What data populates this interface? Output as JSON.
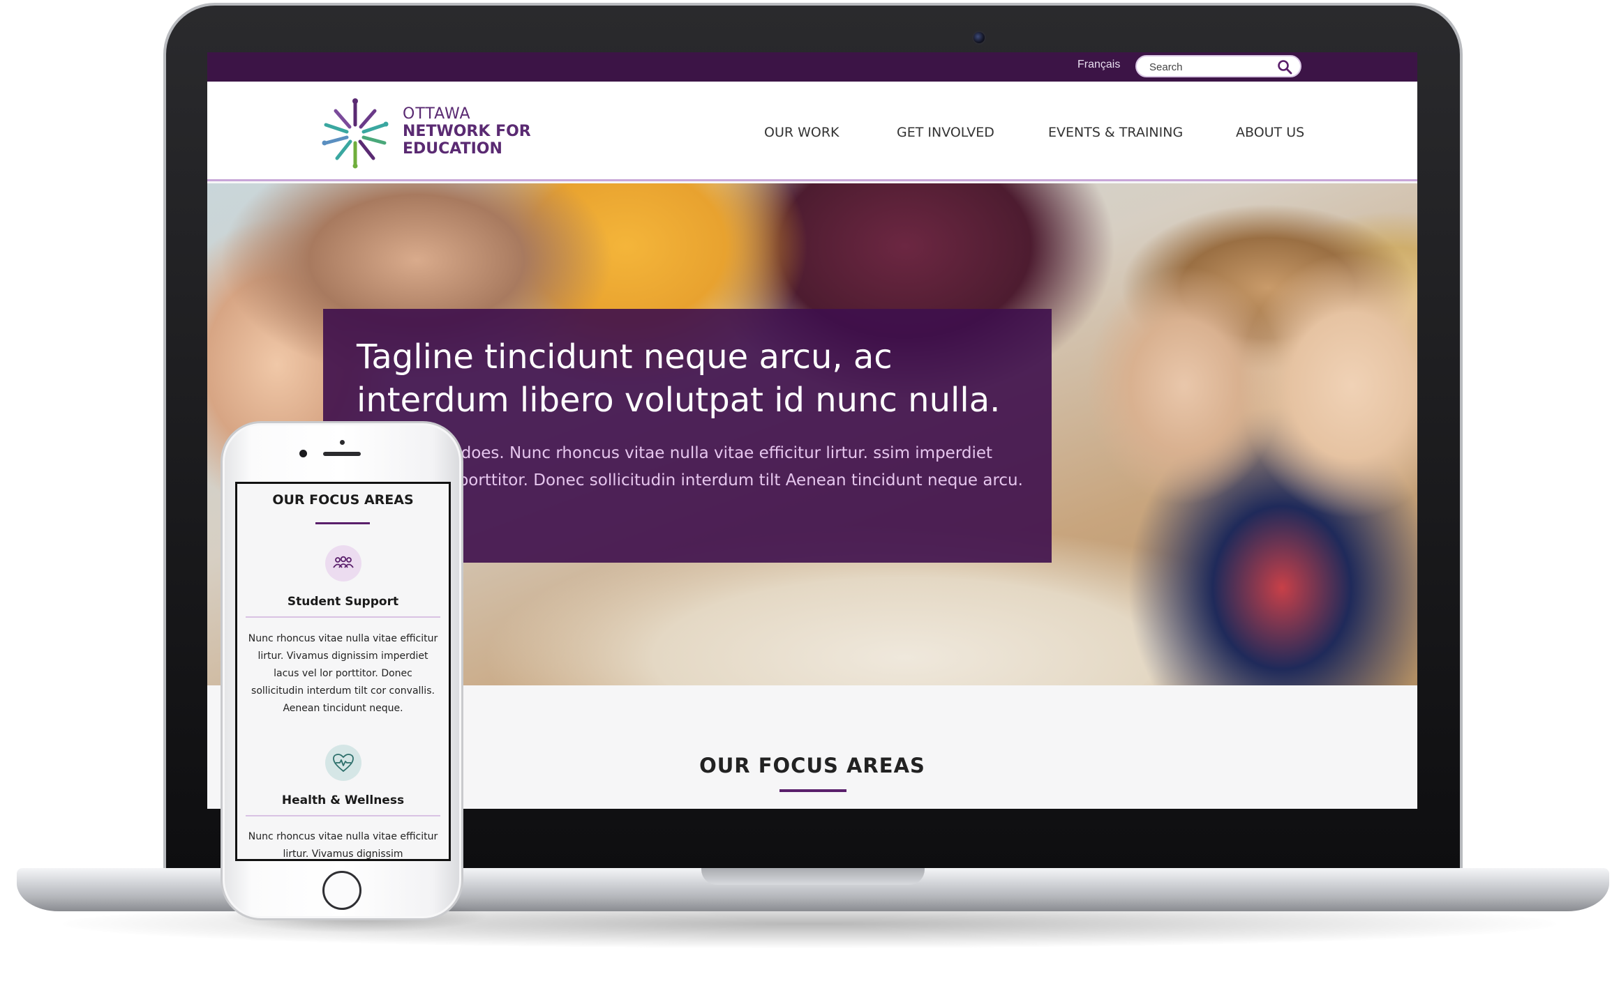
{
  "site": {
    "topbar": {
      "language_link": "Français",
      "search_placeholder": "Search"
    },
    "logo": {
      "line1": "OTTAWA",
      "line2": "NETWORK FOR",
      "line3": "EDUCATION"
    },
    "nav": [
      {
        "label": "OUR WORK"
      },
      {
        "label": "GET INVOLVED"
      },
      {
        "label": "EVENTS & TRAINING"
      },
      {
        "label": "ABOUT US"
      }
    ],
    "hero": {
      "tagline": "Tagline tincidunt neque arcu, ac interdum libero volutpat id nunc nulla.",
      "body": "f what ONFE does. Nunc rhoncus vitae nulla vitae efficitur lirtur. ssim imperdiet lacus vel lor porttitor. Donec sollicitudin interdum tilt Aenean tincidunt neque arcu."
    },
    "focus_title": "OUR FOCUS AREAS"
  },
  "mobile": {
    "focus_title": "OUR FOCUS AREAS",
    "items": [
      {
        "icon": "people-icon",
        "heading": "Student Support",
        "text": "Nunc rhoncus vitae nulla vitae efficitur lirtur. Vivamus dignissim imperdiet lacus vel lor porttitor. Donec sollicitudin interdum tilt cor convallis. Aenean tincidunt neque."
      },
      {
        "icon": "heartbeat-icon",
        "heading": "Health & Wellness",
        "text": "Nunc rhoncus vitae nulla vitae efficitur lirtur. Vivamus dignissim"
      }
    ]
  },
  "colors": {
    "brand_purple": "#3c1446",
    "accent_purple": "#5a1f6b",
    "teal": "#3aa7a0"
  }
}
